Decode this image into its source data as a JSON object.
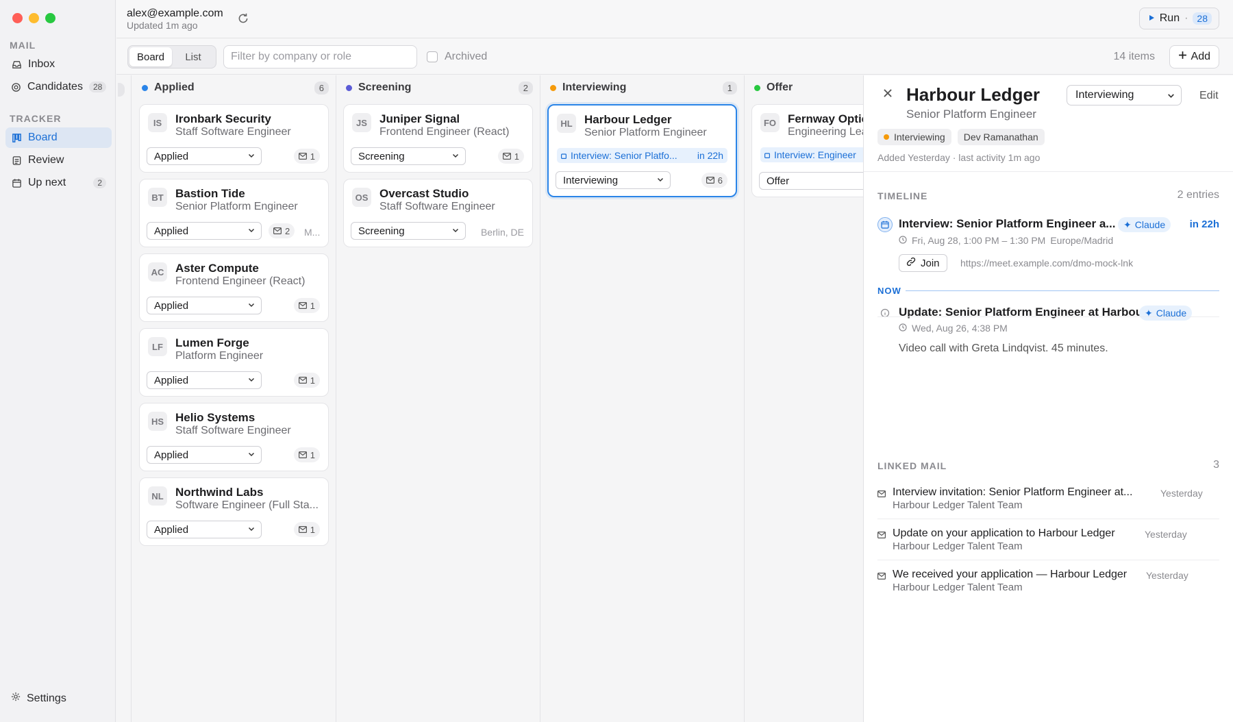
{
  "sidebar": {
    "sections": [
      {
        "label": "MAIL",
        "items": [
          {
            "label": "Inbox",
            "icon": "inbox-icon"
          },
          {
            "label": "Candidates",
            "icon": "candidates-icon",
            "badge": "28"
          }
        ]
      },
      {
        "label": "TRACKER",
        "items": [
          {
            "label": "Board",
            "icon": "board-icon",
            "active": true
          },
          {
            "label": "Review",
            "icon": "review-icon"
          },
          {
            "label": "Up next",
            "icon": "calendar-icon",
            "badge": "2"
          }
        ]
      }
    ],
    "settings_label": "Settings"
  },
  "header": {
    "account_email": "alex@example.com",
    "updated": "Updated 1m ago",
    "run_label": "Run",
    "run_separator": "·",
    "run_count": "28"
  },
  "toolbar": {
    "view_board": "Board",
    "view_list": "List",
    "filter_placeholder": "Filter by company or role",
    "filter_value": "",
    "archived_label": "Archived",
    "items_count": "14 items",
    "add_label": "Add"
  },
  "board": {
    "columns": [
      {
        "name": "Applied",
        "count": "6",
        "color": "#2a84e8",
        "cards": [
          {
            "initials": "IS",
            "company": "Ironbark Security",
            "role": "Staff Software Engineer",
            "stage": "Applied",
            "mail": "1"
          },
          {
            "initials": "BT",
            "company": "Bastion Tide",
            "role": "Senior Platform Engineer",
            "stage": "Applied",
            "mail": "2",
            "extra": "M..."
          },
          {
            "initials": "AC",
            "company": "Aster Compute",
            "role": "Frontend Engineer (React)",
            "stage": "Applied",
            "mail": "1"
          },
          {
            "initials": "LF",
            "company": "Lumen Forge",
            "role": "Platform Engineer",
            "stage": "Applied",
            "mail": "1"
          },
          {
            "initials": "HS",
            "company": "Helio Systems",
            "role": "Staff Software Engineer",
            "stage": "Applied",
            "mail": "1"
          },
          {
            "initials": "NL",
            "company": "Northwind Labs",
            "role": "Software Engineer (Full Sta...",
            "stage": "Applied",
            "mail": "1"
          }
        ]
      },
      {
        "name": "Screening",
        "count": "2",
        "color": "#5b5bd6",
        "cards": [
          {
            "initials": "JS",
            "company": "Juniper Signal",
            "role": "Frontend Engineer (React)",
            "stage": "Screening",
            "mail": "1"
          },
          {
            "initials": "OS",
            "company": "Overcast Studio",
            "role": "Staff Software Engineer",
            "stage": "Screening",
            "extra": "Berlin, DE"
          }
        ]
      },
      {
        "name": "Interviewing",
        "count": "1",
        "color": "#f59a0a",
        "cards": [
          {
            "initials": "HL",
            "company": "Harbour Ledger",
            "role": "Senior Platform Engineer",
            "stage": "Interviewing",
            "mail": "6",
            "event": "Interview: Senior Platfo...",
            "event_when": "in 22h",
            "selected": true
          }
        ]
      },
      {
        "name": "Offer",
        "count": "",
        "color": "#28c840",
        "cards": [
          {
            "initials": "FO",
            "company": "Fernway Optic",
            "role": "Engineering Lea",
            "stage": "Offer",
            "event": "Interview: Engineer"
          }
        ]
      }
    ]
  },
  "detail": {
    "title": "Harbour Ledger",
    "subtitle": "Senior Platform Engineer",
    "stage": "Interviewing",
    "edit_label": "Edit",
    "tag_stage": "Interviewing",
    "tag_person": "Dev Ramanathan",
    "added": "Added Yesterday · last activity 1m ago",
    "timeline_label": "TIMELINE",
    "timeline_count": "2 entries",
    "timeline": [
      {
        "title": "Interview: Senior Platform Engineer a...",
        "badge": "Claude",
        "when": "in 22h",
        "time": "Fri, Aug 28, 1:00 PM – 1:30 PM",
        "tz": "Europe/Madrid",
        "join_label": "Join",
        "link": "https://meet.example.com/dmo-mock-lnk"
      },
      {
        "title": "Update: Senior Platform Engineer at Harbour ...",
        "badge": "Claude",
        "time": "Wed, Aug 26, 4:38 PM",
        "body": "Video call with Greta Lindqvist. 45 minutes."
      }
    ],
    "now_label": "NOW",
    "linked_label": "LINKED MAIL",
    "linked_count": "3",
    "mails": [
      {
        "subject": "Interview invitation: Senior Platform Engineer at...",
        "from": "Harbour Ledger Talent Team",
        "date": "Yesterday"
      },
      {
        "subject": "Update on your application to Harbour Ledger",
        "from": "Harbour Ledger Talent Team",
        "date": "Yesterday"
      },
      {
        "subject": "We received your application — Harbour Ledger",
        "from": "Harbour Ledger Talent Team",
        "date": "Yesterday"
      }
    ]
  }
}
